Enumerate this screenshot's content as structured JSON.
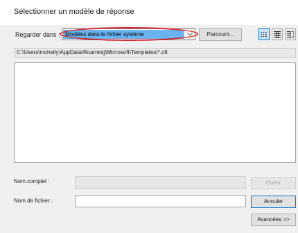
{
  "dialog": {
    "title": "Sélectionner un modèle de réponse"
  },
  "toolbar": {
    "look_in_label": "Regarder dans :",
    "look_in_value": "Modèles dans le fichier système",
    "browse_label": "Parcourir...",
    "view_buttons": [
      "list-view-icon",
      "details-view-icon",
      "preview-view-icon"
    ]
  },
  "path": {
    "value": "C:\\Users\\mchelly\\AppData\\Roaming\\Microsoft\\Templates\\*.oft"
  },
  "form": {
    "full_name_label": "Nom complet :",
    "full_name_value": "",
    "file_name_label": "Nom de fichier :",
    "file_name_value": ""
  },
  "buttons": {
    "open_label": "Ouvrir",
    "cancel_label": "Annuler",
    "advanced_label": "Avancées >>"
  },
  "colors": {
    "highlight": "#6ab3ee",
    "annotation": "#d4222a",
    "focus": "#0078d7"
  }
}
